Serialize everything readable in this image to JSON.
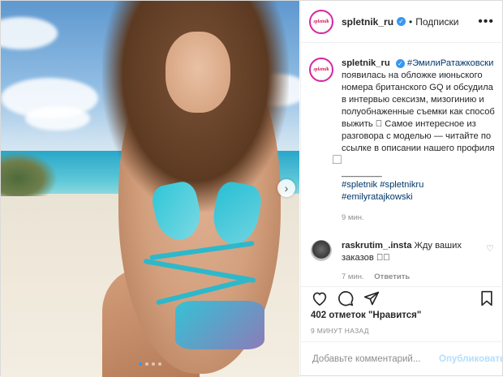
{
  "post": {
    "username": "spletnik_ru",
    "follow_label": "Подписки",
    "more_icon": "more-horizontal-icon",
    "avatar_text": "spletnik",
    "caption": {
      "mention": "#ЭмилиРатажковски",
      "text": "появилась на обложке июньского номера британского GQ и обсудила в интервью сексизм, мизогинию и полуобнаженные съемки как способ выжить ⃞ Самое интересное из разговора с моделью — читайте по ссылке в описании нашего профиля ⃞",
      "divider": "________",
      "hashtags_line1": "#spletnik #spletnikru",
      "hashtags_line2": "#emilyratajkowski",
      "time": "9 мин."
    },
    "comment": {
      "username": "raskrutim_.insta",
      "text": "Жду ваших заказов ⃞⃞",
      "time": "7 мин.",
      "reply_label": "Ответить"
    },
    "likes_text": "402 отметок \"Нравится\"",
    "timestamp": "9 МИНУТ НАЗАД",
    "add_comment_placeholder": "Добавьте комментарий...",
    "publish_label": "Опубликовать",
    "carousel": {
      "total": 4,
      "active": 1
    }
  },
  "colors": {
    "verified": "#3897f0",
    "link": "#00376b",
    "publish": "#b2dffc",
    "muted": "#8e8e8e"
  }
}
